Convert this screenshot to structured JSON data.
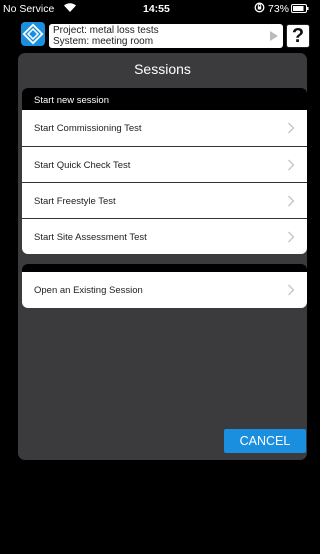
{
  "status_bar": {
    "carrier": "No Service",
    "time": "14:55",
    "battery_percent": "73%"
  },
  "header": {
    "project_line": "Project: metal loss tests",
    "system_line": "System: meeting room",
    "help_label": "?"
  },
  "panel": {
    "title": "Sessions",
    "new_section_label": "Start new session",
    "new_items": [
      {
        "label": "Start Commissioning Test"
      },
      {
        "label": "Start Quick Check Test"
      },
      {
        "label": "Start Freestyle Test"
      },
      {
        "label": "Start Site Assessment Test"
      }
    ],
    "existing_items": [
      {
        "label": "Open an Existing Session"
      }
    ],
    "cancel_label": "CANCEL"
  },
  "colors": {
    "accent": "#1a8fe0",
    "panel_bg": "#3b3b3d"
  },
  "icons": [
    "wifi-icon",
    "rotation-lock-icon",
    "battery-icon",
    "app-logo-icon",
    "chevron-right-icon"
  ]
}
